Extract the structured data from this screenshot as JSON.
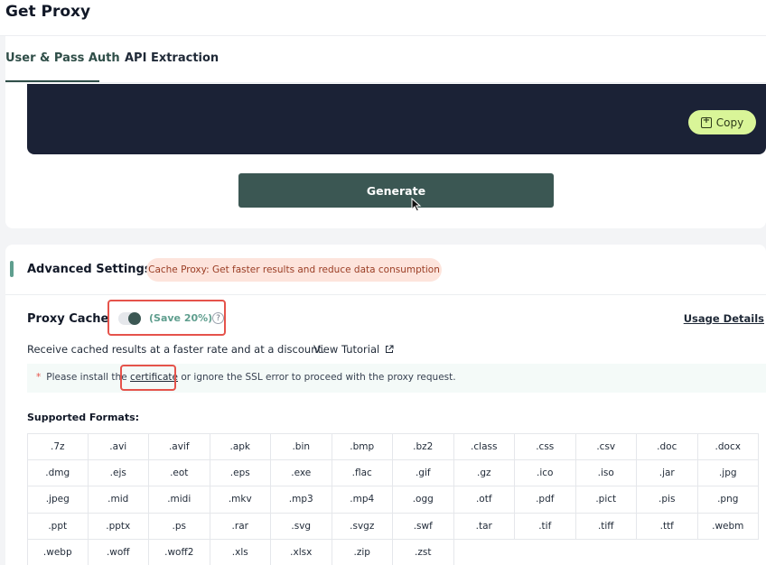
{
  "header": {
    "title": "Get Proxy"
  },
  "tabs": [
    {
      "label": "User & Pass Auth",
      "active": true
    },
    {
      "label": "API Extraction",
      "active": false
    }
  ],
  "code_box": {
    "copy_label": "Copy"
  },
  "generate": {
    "label": "Generate"
  },
  "advanced": {
    "title": "Advanced Settings",
    "pill": "Cache Proxy: Get faster results and reduce data consumption"
  },
  "proxy_cache": {
    "label": "Proxy Cache",
    "enabled": true,
    "save_text": "(Save 20%)",
    "help_glyph": "?",
    "usage_link": "Usage Details",
    "description": "Receive cached results at a faster rate and at a discount.",
    "tutorial_link": "View Tutorial"
  },
  "notice": {
    "asterisk": "*",
    "before": "Please install the ",
    "link": "certificate",
    "after": " or ignore the SSL error to proceed with the proxy request."
  },
  "formats": {
    "title": "Supported Formats:",
    "items": [
      ".7z",
      ".avi",
      ".avif",
      ".apk",
      ".bin",
      ".bmp",
      ".bz2",
      ".class",
      ".css",
      ".csv",
      ".doc",
      ".docx",
      ".dmg",
      ".ejs",
      ".eot",
      ".eps",
      ".exe",
      ".flac",
      ".gif",
      ".gz",
      ".ico",
      ".iso",
      ".jar",
      ".jpg",
      ".jpeg",
      ".mid",
      ".midi",
      ".mkv",
      ".mp3",
      ".mp4",
      ".ogg",
      ".otf",
      ".pdf",
      ".pict",
      ".pis",
      ".png",
      ".ppt",
      ".pptx",
      ".ps",
      ".rar",
      ".svg",
      ".svgz",
      ".swf",
      ".tar",
      ".tif",
      ".tiff",
      ".ttf",
      ".webm",
      ".webp",
      ".woff",
      ".woff2",
      ".xls",
      ".xlsx",
      ".zip",
      ".zst"
    ]
  },
  "colors": {
    "primary": "#3b5753",
    "accent_green": "#5f9e8e",
    "copy_button": "#d9f598",
    "code_background": "#1b2236",
    "highlight_red": "#e5534b",
    "pill_background": "#fde4dc"
  }
}
